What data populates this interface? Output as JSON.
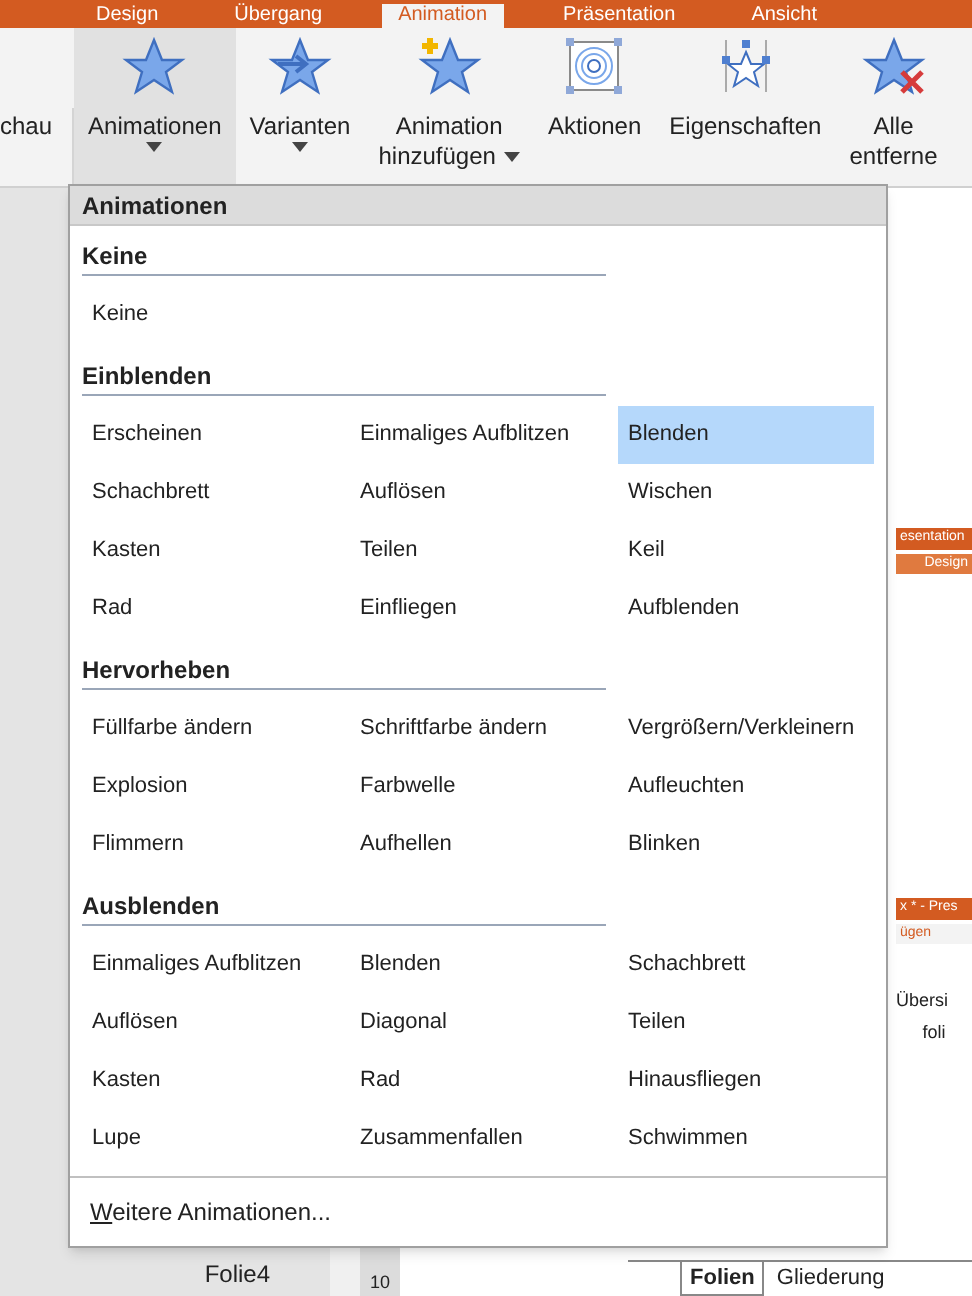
{
  "tabs": [
    {
      "label": "Design",
      "selected": false
    },
    {
      "label": "Übergang",
      "selected": false
    },
    {
      "label": "Animation",
      "selected": true
    },
    {
      "label": "Präsentation",
      "selected": false
    },
    {
      "label": "Ansicht",
      "selected": false
    }
  ],
  "ribbon": {
    "left_cut_label": "chau",
    "buttons": [
      {
        "kind": "star",
        "lines": [
          "Animationen"
        ],
        "dropdown": true,
        "selected": true
      },
      {
        "kind": "star-arrow",
        "lines": [
          "Varianten"
        ],
        "dropdown": true,
        "selected": false
      },
      {
        "kind": "star-plus",
        "lines": [
          "Animation",
          "hinzufügen"
        ],
        "dropdown": true,
        "selected": false
      },
      {
        "kind": "target",
        "lines": [
          "Aktionen"
        ],
        "dropdown": false,
        "selected": false
      },
      {
        "kind": "star-handles",
        "lines": [
          "Eigenschaften"
        ],
        "dropdown": false,
        "selected": false
      },
      {
        "kind": "star-remove",
        "lines": [
          "Alle",
          "entferne"
        ],
        "dropdown": false,
        "selected": false
      }
    ]
  },
  "background": {
    "right_snippets": [
      "esentation",
      "Design",
      "x * - Pres",
      "ügen",
      "Übersi",
      "foli"
    ],
    "slide_label": "Folie4",
    "ruler_number": "10",
    "panel_tabs": [
      {
        "label": "Folien",
        "selected": true
      },
      {
        "label": "Gliederung",
        "selected": false
      }
    ]
  },
  "menu": {
    "title": "Animationen",
    "sections": [
      {
        "title": "Keine",
        "items": [
          {
            "label": "Keine",
            "selected": false
          }
        ]
      },
      {
        "title": "Einblenden",
        "items": [
          {
            "label": "Erscheinen",
            "selected": false
          },
          {
            "label": "Einmaliges Aufblitzen",
            "selected": false
          },
          {
            "label": "Blenden",
            "selected": true
          },
          {
            "label": "Schachbrett",
            "selected": false
          },
          {
            "label": "Auflösen",
            "selected": false
          },
          {
            "label": "Wischen",
            "selected": false
          },
          {
            "label": "Kasten",
            "selected": false
          },
          {
            "label": "Teilen",
            "selected": false
          },
          {
            "label": "Keil",
            "selected": false
          },
          {
            "label": "Rad",
            "selected": false
          },
          {
            "label": "Einfliegen",
            "selected": false
          },
          {
            "label": "Aufblenden",
            "selected": false
          }
        ]
      },
      {
        "title": "Hervorheben",
        "items": [
          {
            "label": "Füllfarbe ändern",
            "selected": false
          },
          {
            "label": "Schriftfarbe ändern",
            "selected": false
          },
          {
            "label": "Vergrößern/Verkleinern",
            "selected": false
          },
          {
            "label": "Explosion",
            "selected": false
          },
          {
            "label": "Farbwelle",
            "selected": false
          },
          {
            "label": "Aufleuchten",
            "selected": false
          },
          {
            "label": "Flimmern",
            "selected": false
          },
          {
            "label": "Aufhellen",
            "selected": false
          },
          {
            "label": "Blinken",
            "selected": false
          }
        ]
      },
      {
        "title": "Ausblenden",
        "items": [
          {
            "label": "Einmaliges Aufblitzen",
            "selected": false
          },
          {
            "label": "Blenden",
            "selected": false
          },
          {
            "label": "Schachbrett",
            "selected": false
          },
          {
            "label": "Auflösen",
            "selected": false
          },
          {
            "label": "Diagonal",
            "selected": false
          },
          {
            "label": "Teilen",
            "selected": false
          },
          {
            "label": "Kasten",
            "selected": false
          },
          {
            "label": "Rad",
            "selected": false
          },
          {
            "label": "Hinausfliegen",
            "selected": false
          },
          {
            "label": "Lupe",
            "selected": false
          },
          {
            "label": "Zusammenfallen",
            "selected": false
          },
          {
            "label": "Schwimmen",
            "selected": false
          }
        ]
      }
    ],
    "footer": {
      "access_key": "W",
      "rest": "eitere Animationen..."
    }
  }
}
